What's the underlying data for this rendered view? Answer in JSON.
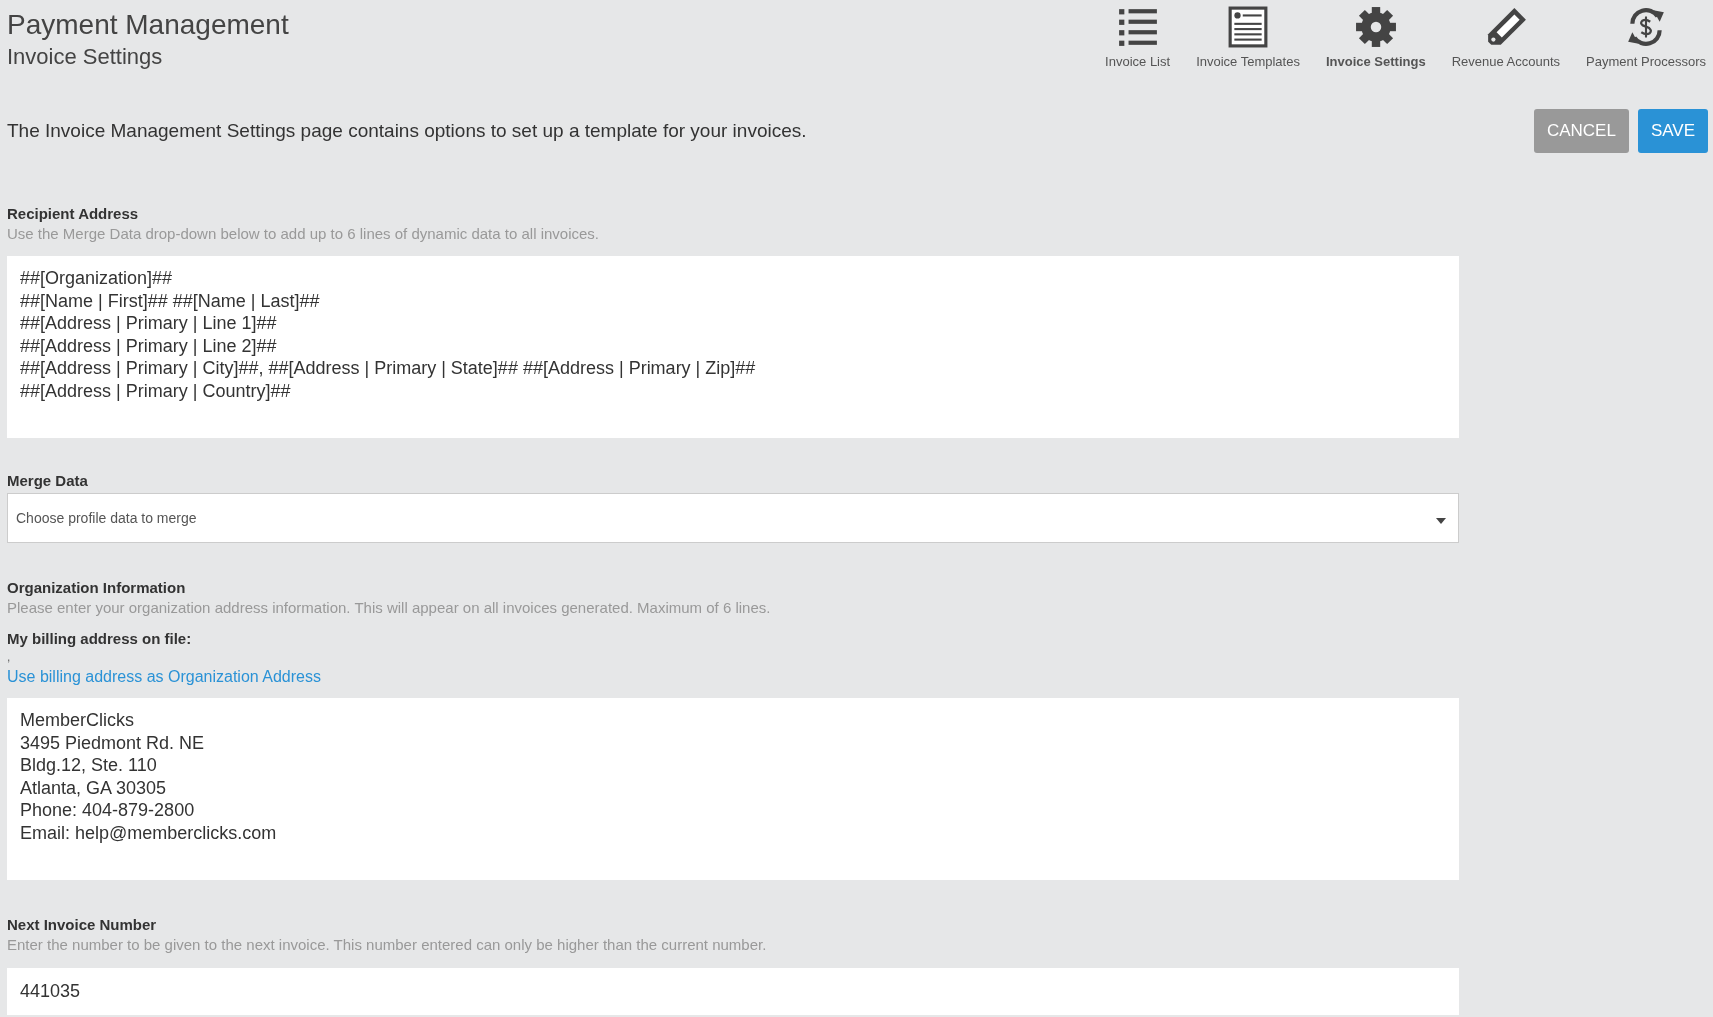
{
  "header": {
    "title": "Payment Management",
    "subtitle": "Invoice Settings"
  },
  "nav": [
    {
      "label": "Invoice List",
      "selected": false
    },
    {
      "label": "Invoice Templates",
      "selected": false
    },
    {
      "label": "Invoice Settings",
      "selected": true
    },
    {
      "label": "Revenue Accounts",
      "selected": false
    },
    {
      "label": "Payment Processors",
      "selected": false
    }
  ],
  "intro": "The Invoice Management Settings page contains options to set up a template for your invoices.",
  "buttons": [
    {
      "label": "CANCEL",
      "kind": "secondary"
    },
    {
      "label": "SAVE",
      "kind": "primary"
    }
  ],
  "recipient_address": {
    "label": "Recipient Address",
    "help": "Use the Merge Data drop-down below to add up to 6 lines of dynamic data to all invoices.",
    "value": [
      "##[Organization]##",
      "##[Name | First]## ##[Name | Last]##",
      "##[Address | Primary | Line 1]##",
      "##[Address | Primary | Line 2]##",
      "##[Address | Primary | City]##, ##[Address | Primary | State]## ##[Address | Primary | Zip]##",
      "##[Address | Primary | Country]##"
    ]
  },
  "merge_data": {
    "label": "Merge Data",
    "placeholder": "Choose profile data to merge"
  },
  "organization_information": {
    "label": "Organization Information",
    "help": "Please enter your organization address information. This will appear on all invoices generated. Maximum of 6 lines.",
    "billing_label": "My billing address on file:",
    "billing_value": ",",
    "link": "Use billing address as Organization Address",
    "value": [
      "MemberClicks",
      "3495 Piedmont Rd. NE",
      "Bldg.12, Ste. 110",
      "Atlanta, GA 30305",
      "Phone: 404-879-2800",
      "Email: help@memberclicks.com"
    ]
  },
  "next_invoice_number": {
    "label": "Next Invoice Number",
    "help": "Enter the number to be given to the next invoice. This number entered can only be higher than the current number.",
    "value": "441035"
  }
}
